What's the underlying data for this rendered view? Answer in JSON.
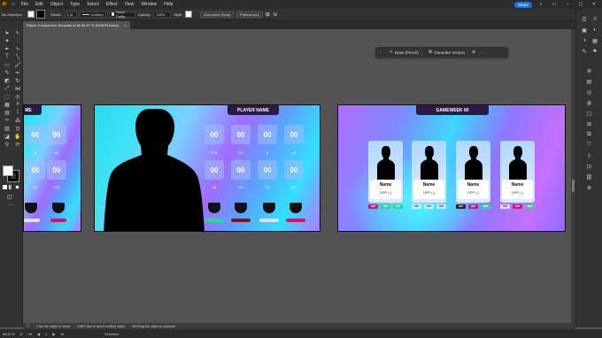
{
  "app": {
    "logo": "Ai",
    "menus": [
      "File",
      "Edit",
      "Object",
      "Type",
      "Select",
      "Effect",
      "View",
      "Window",
      "Help"
    ],
    "share_label": "Share"
  },
  "control_bar": {
    "selection": "No Selection",
    "stroke_label": "Stroke:",
    "stroke_value": "1 pt",
    "uniform_label": "Uniform",
    "brush_label": "Touch Callig...",
    "opacity_label": "Opacity:",
    "opacity_value": "100%",
    "style_label": "Style:",
    "doc_setup": "Document Setup",
    "preferences": "Preferences"
  },
  "document_tab": {
    "title": "Player Comparison Template.ai @ 66.67 % (RGB/Preview)",
    "close": "×"
  },
  "context_bar": {
    "draw": "Draw (Pencil)",
    "generate": "Generate Vectors",
    "more": "···"
  },
  "artboard_left": {
    "title": "ME",
    "tiles": [
      {
        "value": "00",
        "label": "A"
      },
      {
        "value": "00",
        "label": "xG"
      },
      {
        "value": "00",
        "label": "CS"
      },
      {
        "value": "00",
        "label": "xCS"
      }
    ]
  },
  "artboard_middle": {
    "title": "PLAYER NAME",
    "tiles": [
      {
        "value": "00",
        "label": "PTS"
      },
      {
        "value": "00",
        "label": "GS"
      },
      {
        "value": "00",
        "label": "A"
      },
      {
        "value": "00",
        "label": "xG"
      },
      {
        "value": "00",
        "label": "xA"
      },
      {
        "value": "00",
        "label": "xGI"
      },
      {
        "value": "00",
        "label": "CS"
      },
      {
        "value": "00",
        "label": "xCS"
      }
    ],
    "bar_colors": [
      "#22e08a",
      "#8a1030",
      "#e0e0ff",
      "#e0106a"
    ]
  },
  "artboard_right": {
    "title": "GAMEWEEK 00",
    "cards": [
      {
        "name": "Name",
        "opp": "OPP (-)",
        "chips": [
          {
            "t": "OPP",
            "c": "#e0106a"
          },
          {
            "t": "OPP",
            "c": "#22e08a"
          },
          {
            "t": "OPP",
            "c": "#22e08a"
          }
        ]
      },
      {
        "name": "Name",
        "opp": "OPP (-)",
        "chips": [
          {
            "t": "OPP",
            "c": "#e0e0ff"
          },
          {
            "t": "OPP",
            "c": "#e0e0ff"
          },
          {
            "t": "OPP",
            "c": "#e0e0ff"
          }
        ]
      },
      {
        "name": "Name",
        "opp": "OPP (-)",
        "chips": [
          {
            "t": "OPP",
            "c": "#5a0a20"
          },
          {
            "t": "OPP",
            "c": "#e0106a"
          },
          {
            "t": "OPP",
            "c": "#22e08a"
          }
        ]
      },
      {
        "name": "Name",
        "opp": "OPP (-)",
        "chips": [
          {
            "t": "OPP",
            "c": "#e0e0ff"
          },
          {
            "t": "OPP",
            "c": "#e0106a"
          },
          {
            "t": "OPP",
            "c": "#22e08a"
          }
        ]
      }
    ]
  },
  "status_bar": {
    "hint1": "Click the object to select",
    "hint2": "Shift+Click to select multiple object",
    "hint3": "Alt+Drag the object to duplicate"
  },
  "bottom_bar": {
    "zoom": "66.67%",
    "rotate": "0°",
    "artboard_nav": "1",
    "mode": "Selection"
  }
}
